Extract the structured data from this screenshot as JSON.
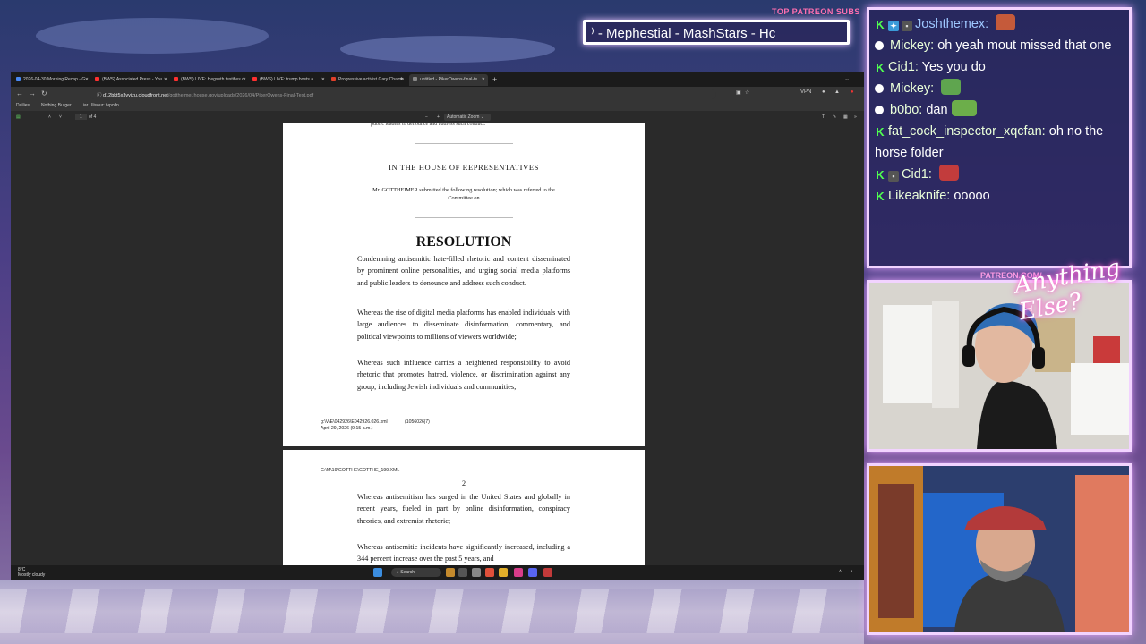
{
  "overlay": {
    "patreon_subs_label": "TOP PATREON SUBS",
    "ticker_text": "⁾ - Mephestial - MashStars - Hc",
    "patreon_tag": "PATREON.COM/",
    "logo_text": "Anything Else?"
  },
  "chat": {
    "messages": [
      {
        "user": "Joshthemex:",
        "text": "",
        "emote": true,
        "emote_color": "#c55a3a"
      },
      {
        "user": "Mickey:",
        "text": "oh yeah mout missed that one",
        "emote": false
      },
      {
        "user": "Cid1:",
        "text": "Yes you do",
        "emote": false
      },
      {
        "user": "Mickey:",
        "text": "",
        "emote": true,
        "emote_color": "#5fa54f"
      },
      {
        "user": "b0bo:",
        "text": "dan",
        "emote": true,
        "emote_color": "#6cae4a"
      },
      {
        "user": "fat_cock_inspector_xqcfan:",
        "text": "oh no the horse folder",
        "emote": false
      },
      {
        "user": "Cid1:",
        "text": "",
        "emote": true,
        "emote_color": "#c23c3c"
      },
      {
        "user": "Likeaknife:",
        "text": "ooooo",
        "emote": false
      }
    ]
  },
  "browser": {
    "tabs": [
      {
        "label": "2026-04-30 Morning Recap - G",
        "color": "#4a8af4"
      },
      {
        "label": "(BWS) Associated Press - You",
        "color": "#ff3030"
      },
      {
        "label": "(BWS) LIVE: Hegseth testifies o",
        "color": "#ff3030"
      },
      {
        "label": "(BWS) LIVE: trump hosts a",
        "color": "#ff3030"
      },
      {
        "label": "Progressive activist Gary Chamb",
        "color": "#e0402a"
      },
      {
        "label": "untitled - PikerOwens-final-te",
        "color": "#888888"
      }
    ],
    "url_host": "d12bkt5x3vyizu.cloudfront.net",
    "url_path": "/gottheimer.house.gov/uploads/2026/04/PikerOwens-Final-Text.pdf",
    "vpn_label": "VPN",
    "bookmarks": [
      "Dailies",
      "Nothing Burger",
      "Liar Ulisour: tvpcdn..."
    ],
    "pdf_page_current": "1",
    "pdf_page_total": "of 4",
    "zoom": "Automatic Zoom"
  },
  "pdf": {
    "top_fragment": "public leaders to denounce and address such conduct.",
    "chamber": "IN THE HOUSE OF REPRESENTATIVES",
    "submitted": "Mr. GOTTHEIMER submitted the following resolution; which was referred to the Committee on",
    "heading": "RESOLUTION",
    "title_para": "Condemning antisemitic hate-filled rhetoric and content disseminated by prominent online personalities, and urging social media platforms and public leaders to denounce and address such conduct.",
    "whereas1": "Whereas the rise of digital media platforms has enabled individuals with large audiences to disseminate disinformation, commentary, and political viewpoints to millions of viewers worldwide;",
    "whereas2": "Whereas such influence carries a heightened responsibility to avoid rhetoric that promotes hatred, violence, or discrimination against any group, including Jewish individuals and communities;",
    "footer_file": "g:\\V\\E\\042926\\E042926.026.xml",
    "footer_id": "(1056026|7)",
    "footer_date": "April 29, 2026 (9:15 a.m.)",
    "page2_header": "G:\\M\\19\\GOTTHE\\GOTTHE_199.XML",
    "page2_number": "2",
    "whereas3": "Whereas antisemitism has surged in the United States and globally in recent years, fueled in part by online disinformation, conspiracy theories, and extremist rhetoric;",
    "whereas4": "Whereas antisemitic incidents have significantly increased, including a 344 percent increase over the past 5 years, and"
  },
  "taskbar": {
    "temp": "8°C",
    "weather": "Mostly cloudy",
    "search_placeholder": "Search"
  }
}
